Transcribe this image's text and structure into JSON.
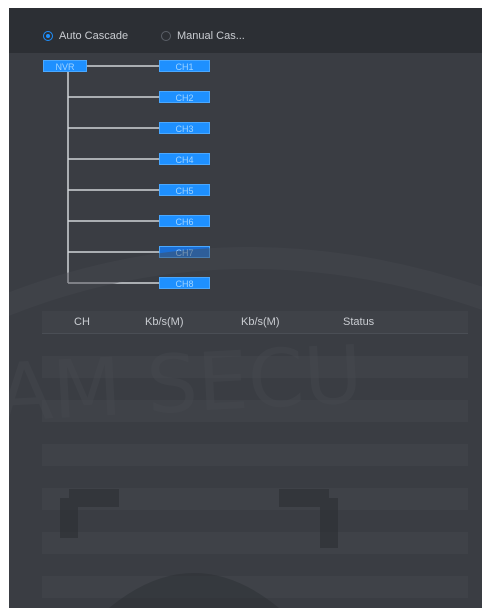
{
  "cascade_mode": {
    "options": [
      {
        "label": "Auto Cascade",
        "selected": true
      },
      {
        "label": "Manual Cas...",
        "selected": false
      }
    ]
  },
  "topology": {
    "root_label": "NVR",
    "channels": [
      "CH1",
      "CH2",
      "CH3",
      "CH4",
      "CH5",
      "CH6",
      "CH7",
      "CH8"
    ],
    "highlighted_channel": "CH7"
  },
  "table": {
    "headers": [
      "CH",
      "Kb/s(M)",
      "Kb/s(M)",
      "Status"
    ],
    "rows": []
  },
  "colors": {
    "accent": "#1e90ff",
    "background": "#3a3d43",
    "header": "#2c2f34"
  }
}
